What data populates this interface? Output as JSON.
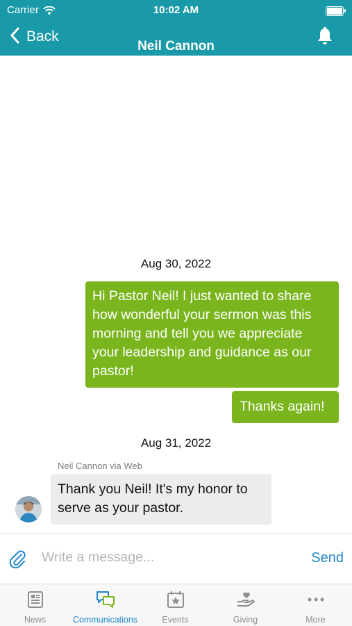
{
  "status_bar": {
    "carrier": "Carrier",
    "time": "10:02 AM"
  },
  "nav": {
    "back_label": "Back",
    "title": "Neil Cannon",
    "icons": [
      "chevron-left-icon",
      "bell-icon"
    ]
  },
  "messages": {
    "date_1": "Aug 30, 2022",
    "out_1_lines": [
      "Hi Pastor Neil! I just wanted to share",
      "how wonderful your sermon was this",
      "morning and tell you we appreciate",
      "your leadership and guidance as our",
      "pastor!"
    ],
    "out_2": "Thanks again!",
    "date_2": "Aug 31, 2022",
    "in_sender": "Neil Cannon via Web",
    "in_1_lines": [
      "Thank you Neil! It's my honor to",
      "serve as your pastor."
    ]
  },
  "composer": {
    "placeholder": "Write a message...",
    "send_label": "Send"
  },
  "tabs": [
    {
      "label": "News",
      "icon": "newspaper-icon"
    },
    {
      "label": "Communications",
      "icon": "chat-bubbles-icon",
      "active": true
    },
    {
      "label": "Events",
      "icon": "calendar-star-icon"
    },
    {
      "label": "Giving",
      "icon": "hand-heart-icon"
    },
    {
      "label": "More",
      "icon": "more-dots-icon"
    }
  ],
  "colors": {
    "header": "#1a9aa8",
    "outgoing_bubble": "#7ab51d",
    "incoming_bubble": "#ececee",
    "accent": "#1f87c7"
  }
}
